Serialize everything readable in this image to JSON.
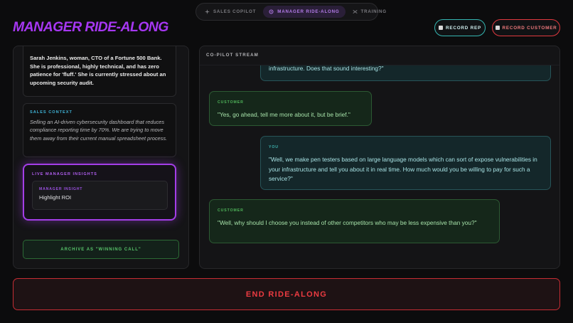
{
  "nav": {
    "tabs": [
      {
        "label": "SALES COPILOT",
        "icon": "sparkle-icon",
        "active": false
      },
      {
        "label": "MANAGER RIDE-ALONG",
        "icon": "gear-icon",
        "active": true
      },
      {
        "label": "TRAINING",
        "icon": "shuffle-icon",
        "active": false
      }
    ]
  },
  "header": {
    "title": "MANAGER RIDE-ALONG",
    "record_rep_label": "RECORD REP",
    "record_customer_label": "RECORD CUSTOMER"
  },
  "persona": {
    "text": "Sarah Jenkins, woman, CTO of a Fortune 500 Bank. She is professional, highly technical, and has zero patience for 'fluff.' She is currently stressed about an upcoming security audit."
  },
  "sales_context": {
    "label": "SALES CONTEXT",
    "text": "Selling an AI-driven cybersecurity dashboard that reduces compliance reporting time by 70%. We are trying to move them away from their current manual spreadsheet process."
  },
  "insights": {
    "label": "LIVE MANAGER INSIGHTS",
    "item_label": "MANAGER INSIGHT",
    "item_value": "Highlight ROI"
  },
  "archive_label": "ARCHIVE AS \"WINNING CALL\"",
  "stream": {
    "title": "CO-PILOT STREAM",
    "messages": [
      {
        "speaker": "",
        "text": "infrastructure. Does that sound interesting?\""
      },
      {
        "speaker": "CUSTOMER",
        "text": "\"Yes, go ahead, tell me more about it, but be brief.\""
      },
      {
        "speaker": "YOU",
        "text": "\"Well, we make pen testers based on large language models which can sort of expose vulnerabilities in your infrastructure and tell you about it in real time. How much would you be willing to pay for such a service?\""
      },
      {
        "speaker": "CUSTOMER",
        "text": "\"Well, why should I choose you instead of other competitors who may be less expensive than you?\""
      }
    ]
  },
  "end_label": "END RIDE-ALONG",
  "colors": {
    "accent_purple": "#a637f2",
    "teal": "#35b6b1",
    "red": "#e1393f",
    "green": "#58c46a"
  }
}
